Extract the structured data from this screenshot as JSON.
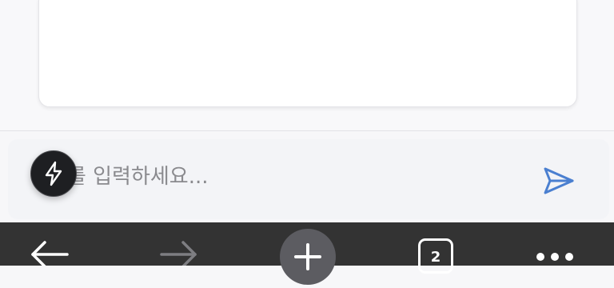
{
  "composer": {
    "placeholder": "지를 입력하세요..."
  },
  "toolbar": {
    "tab_count": "2"
  },
  "icons": {
    "quick_action": "lightning-icon",
    "send": "send-icon",
    "back": "arrow-left-icon",
    "forward": "arrow-right-icon",
    "new_tab": "plus-icon",
    "menu": "more-horizontal-icon"
  },
  "colors": {
    "send_icon": "#4a7fd0",
    "toolbar_background": "#333333",
    "quick_action_background": "#1e1f22"
  }
}
